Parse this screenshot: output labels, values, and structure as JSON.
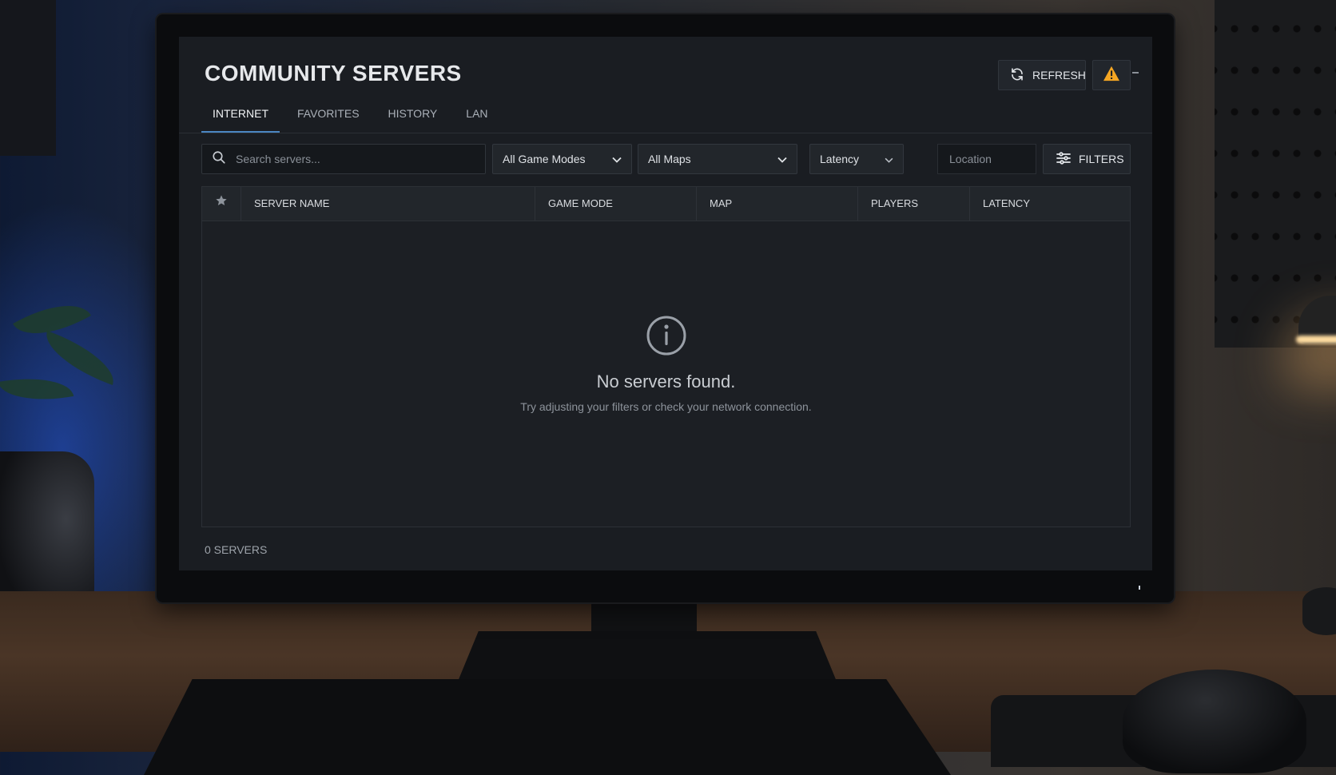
{
  "window": {
    "title": "COMMUNITY SERVERS"
  },
  "header": {
    "refresh_label": "REFRESH",
    "warning_icon": "warning-icon",
    "accent": "#4b86c2",
    "warning_color": "#f5a623"
  },
  "tabs": [
    {
      "label": "INTERNET",
      "active": true
    },
    {
      "label": "FAVORITES",
      "active": false
    },
    {
      "label": "HISTORY",
      "active": false
    },
    {
      "label": "LAN",
      "active": false
    }
  ],
  "filters": {
    "search_placeholder": "Search servers...",
    "game_mode": "All Game Modes",
    "map": "All Maps",
    "sort": "Latency",
    "location_placeholder": "Location",
    "filters_label": "FILTERS"
  },
  "table": {
    "columns": [
      "SERVER NAME",
      "GAME MODE",
      "MAP",
      "PLAYERS",
      "LATENCY"
    ],
    "rows": []
  },
  "empty_state": {
    "icon": "info-icon",
    "title": "No servers found.",
    "subtitle": "Try adjusting your filters or check your network connection."
  },
  "footer": {
    "server_count": "0 SERVERS"
  }
}
